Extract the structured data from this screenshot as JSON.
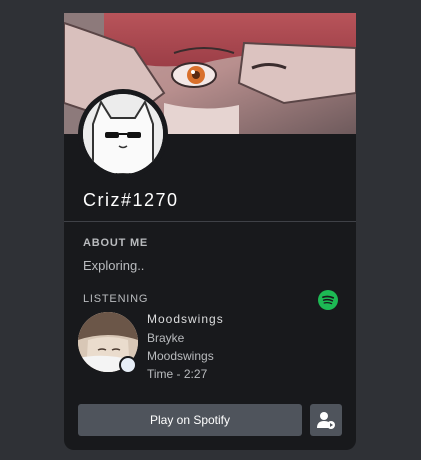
{
  "profile": {
    "username": "Criz#1270"
  },
  "about": {
    "title": "ABOUT ME",
    "text": "Exploring.."
  },
  "activity": {
    "title": "LISTENING",
    "icon": "spotify-icon",
    "track": {
      "title": "Moodswings",
      "artist": "Brayke",
      "album": "Moodswings",
      "time_label": "Time -  2:27"
    }
  },
  "actions": {
    "play_label": "Play on Spotify",
    "profile_icon": "user-profile-icon"
  },
  "colors": {
    "background": "#2f3136",
    "card": "#18191c",
    "button": "#4f545c",
    "spotify": "#1db954"
  }
}
